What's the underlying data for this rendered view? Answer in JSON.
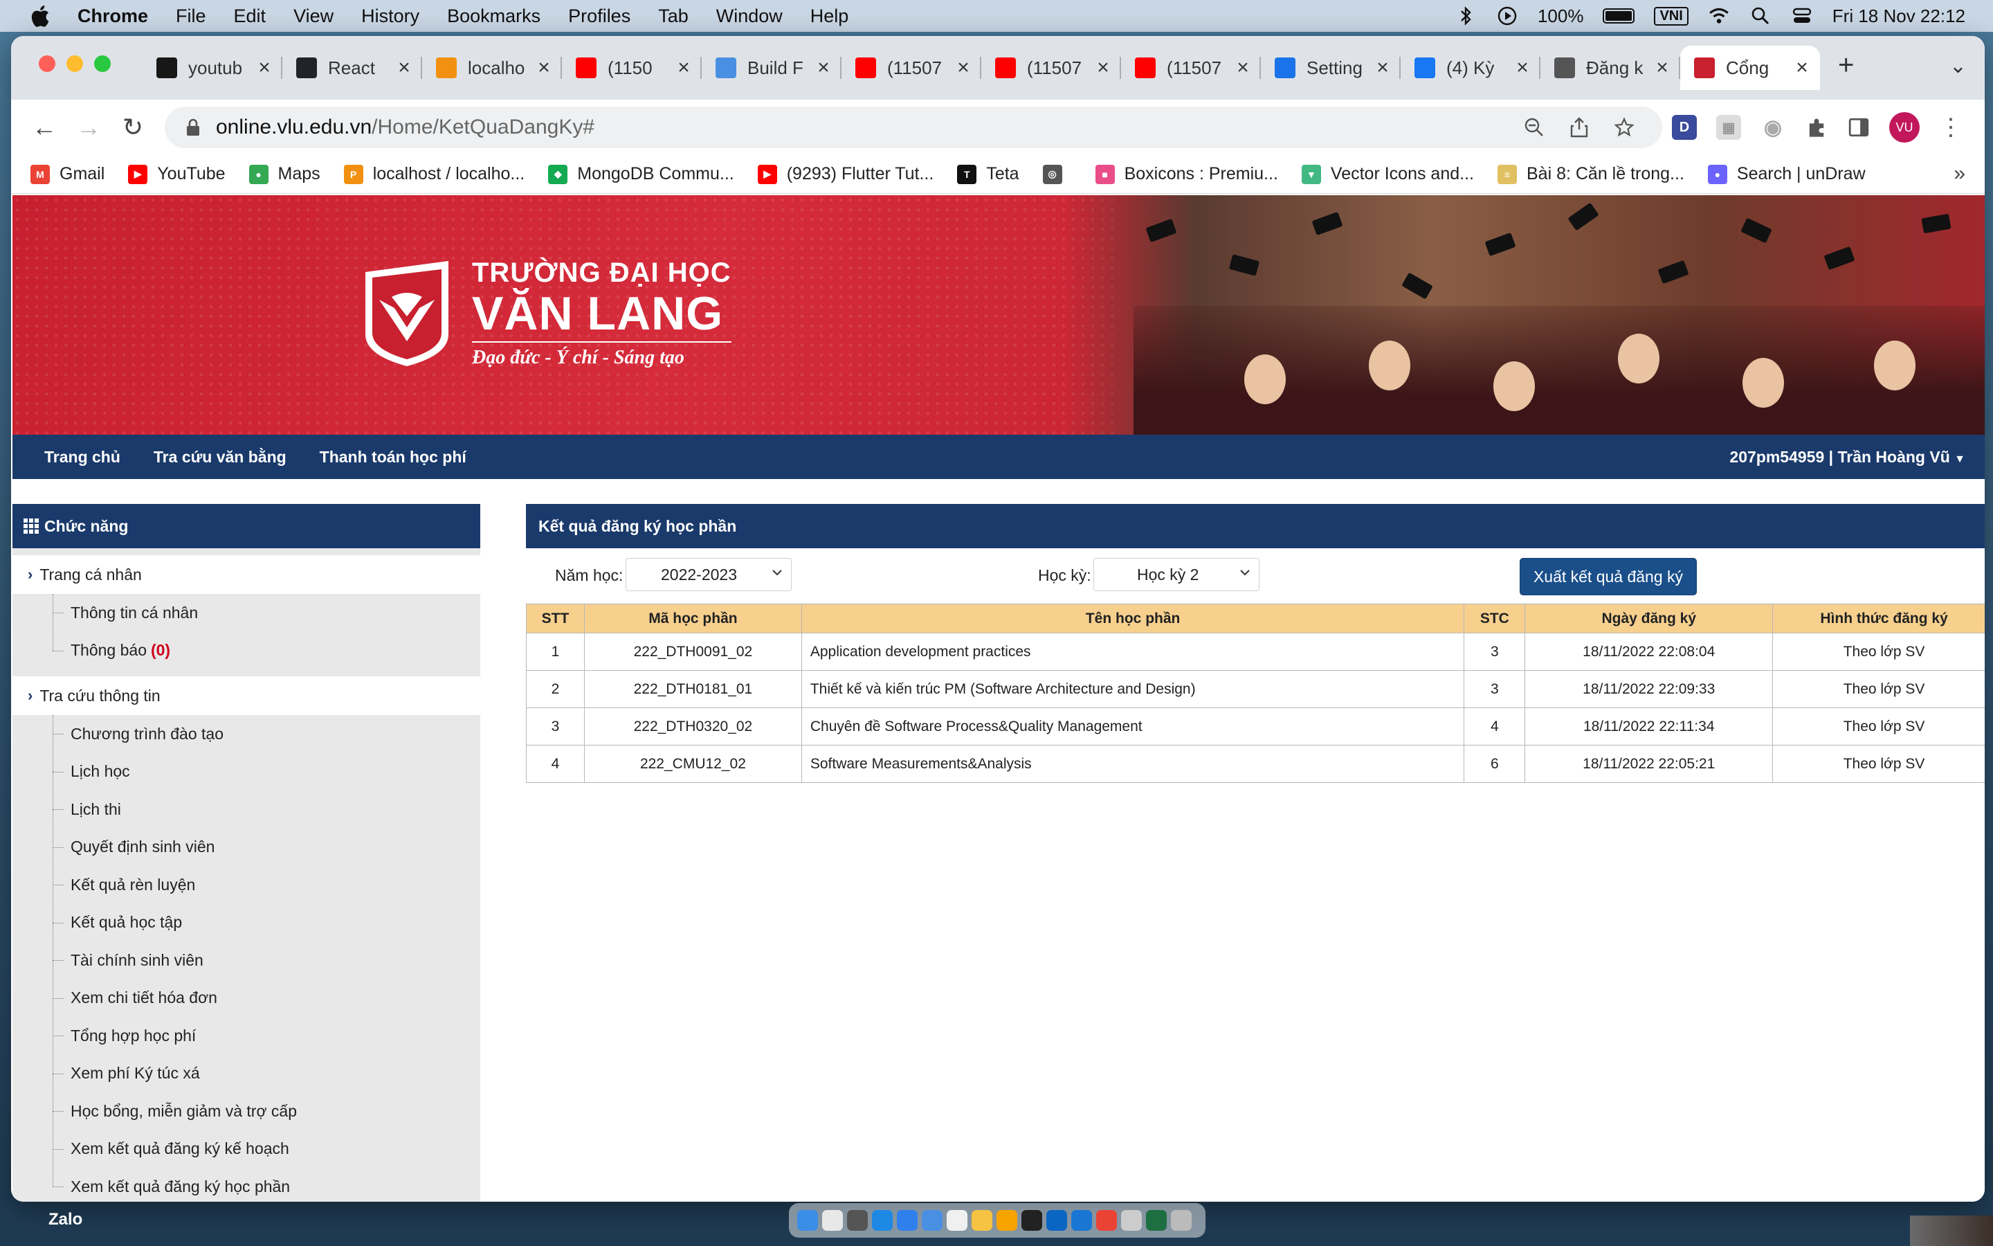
{
  "menubar": {
    "app": "Chrome",
    "items": [
      "File",
      "Edit",
      "View",
      "History",
      "Bookmarks",
      "Profiles",
      "Tab",
      "Window",
      "Help"
    ],
    "battery": "100%",
    "input_method": "VNI",
    "datetime": "Fri 18 Nov  22:12"
  },
  "tabs": [
    {
      "title": "youtub",
      "icon": "github-icon",
      "color": "#181717"
    },
    {
      "title": "React",
      "icon": "react-icon",
      "color": "#20232a"
    },
    {
      "title": "localho",
      "icon": "phpmyadmin-icon",
      "color": "#f29111"
    },
    {
      "title": "(1150",
      "icon": "youtube-icon",
      "color": "#ff0000"
    },
    {
      "title": "Build F",
      "icon": "build-icon",
      "color": "#4a90e2"
    },
    {
      "title": "(11507",
      "icon": "youtube-icon",
      "color": "#ff0000"
    },
    {
      "title": "(11507",
      "icon": "youtube-icon",
      "color": "#ff0000"
    },
    {
      "title": "(11507",
      "icon": "youtube-icon",
      "color": "#ff0000"
    },
    {
      "title": "Setting",
      "icon": "settings-icon",
      "color": "#1a73e8"
    },
    {
      "title": "(4) Kỳ",
      "icon": "facebook-icon",
      "color": "#1877f2"
    },
    {
      "title": "Đăng k",
      "icon": "globe-icon",
      "color": "#555555"
    },
    {
      "title": "Cổng",
      "icon": "vlu-icon",
      "color": "#c8202f"
    }
  ],
  "address": {
    "host": "online.vlu.edu.vn",
    "path": "/Home/KetQuaDangKy#"
  },
  "profile_initials": "VU",
  "bookmarks": [
    {
      "label": "Gmail",
      "icon": "gmail-icon",
      "color": "#ea4335",
      "glyph": "M"
    },
    {
      "label": "YouTube",
      "icon": "youtube-icon",
      "color": "#ff0000",
      "glyph": "▶"
    },
    {
      "label": "Maps",
      "icon": "maps-icon",
      "color": "#34a853",
      "glyph": "●"
    },
    {
      "label": "localhost / localho...",
      "icon": "phpmyadmin-icon",
      "color": "#f29111",
      "glyph": "P"
    },
    {
      "label": "MongoDB Commu...",
      "icon": "mongodb-icon",
      "color": "#13aa52",
      "glyph": "◆"
    },
    {
      "label": "(9293) Flutter Tut...",
      "icon": "youtube-icon",
      "color": "#ff0000",
      "glyph": "▶"
    },
    {
      "label": "Teta",
      "icon": "teta-icon",
      "color": "#111111",
      "glyph": "T"
    },
    {
      "label": "",
      "icon": "globe-icon",
      "color": "#555555",
      "glyph": "◎"
    },
    {
      "label": "Boxicons : Premiu...",
      "icon": "boxicons-icon",
      "color": "#e94d8a",
      "glyph": "■"
    },
    {
      "label": "Vector Icons and...",
      "icon": "vector-icon",
      "color": "#42b883",
      "glyph": "▼"
    },
    {
      "label": "Bài 8: Căn lề trong...",
      "icon": "doc-icon",
      "color": "#e0c060",
      "glyph": "≡"
    },
    {
      "label": "Search | unDraw",
      "icon": "undraw-icon",
      "color": "#6c63ff",
      "glyph": "●"
    }
  ],
  "site": {
    "logo_line1": "TRƯỜNG ĐẠI HỌC",
    "logo_line2": "VĂN LANG",
    "logo_slogan": "Đạo đức - Ý chí - Sáng tạo",
    "nav": [
      "Trang chủ",
      "Tra cứu văn bằng",
      "Thanh toán học phí"
    ],
    "user": "207pm54959 | Trần Hoàng Vũ"
  },
  "sidebar": {
    "title": "Chức năng",
    "group1": {
      "label": "Trang cá nhân",
      "items": [
        "Thông tin cá nhân",
        "Thông báo"
      ],
      "notification_count": "(0)"
    },
    "group2": {
      "label": "Tra cứu thông tin",
      "items": [
        "Chương trình đào tạo",
        "Lịch học",
        "Lịch thi",
        "Quyết định sinh viên",
        "Kết quả rèn luyện",
        "Kết quả học tập",
        "Tài chính sinh viên",
        "Xem chi tiết hóa đơn",
        "Tổng hợp học phí",
        "Xem phí Ký túc xá",
        "Học bổng, miễn giảm và trợ cấp",
        "Xem kết quả đăng ký kế hoạch",
        "Xem kết quả đăng ký học phần"
      ]
    }
  },
  "main": {
    "title": "Kết quả đăng ký học phần",
    "year_label": "Năm học:",
    "year_value": "2022-2023",
    "term_label": "Học kỳ:",
    "term_value": "Học kỳ 2",
    "export_label": "Xuất kết quả đăng ký",
    "columns": [
      "STT",
      "Mã học phần",
      "Tên học phần",
      "STC",
      "Ngày đăng ký",
      "Hình thức đăng ký"
    ],
    "rows": [
      [
        "1",
        "222_DTH0091_02",
        "Application development practices",
        "3",
        "18/11/2022 22:08:04",
        "Theo lớp SV"
      ],
      [
        "2",
        "222_DTH0181_01",
        "Thiết kế và kiến trúc PM (Software Architecture and Design)",
        "3",
        "18/11/2022 22:09:33",
        "Theo lớp SV"
      ],
      [
        "3",
        "222_DTH0320_02",
        "Chuyên đề Software Process&Quality Management",
        "4",
        "18/11/2022 22:11:34",
        "Theo lớp SV"
      ],
      [
        "4",
        "222_CMU12_02",
        "Software Measurements&Analysis",
        "6",
        "18/11/2022 22:05:21",
        "Theo lớp SV"
      ]
    ]
  },
  "dock": {
    "zalo_label": "Zalo"
  },
  "colors": {
    "navy": "#1a3a6b",
    "brand_red": "#c8202f",
    "table_header": "#f7d08e"
  }
}
